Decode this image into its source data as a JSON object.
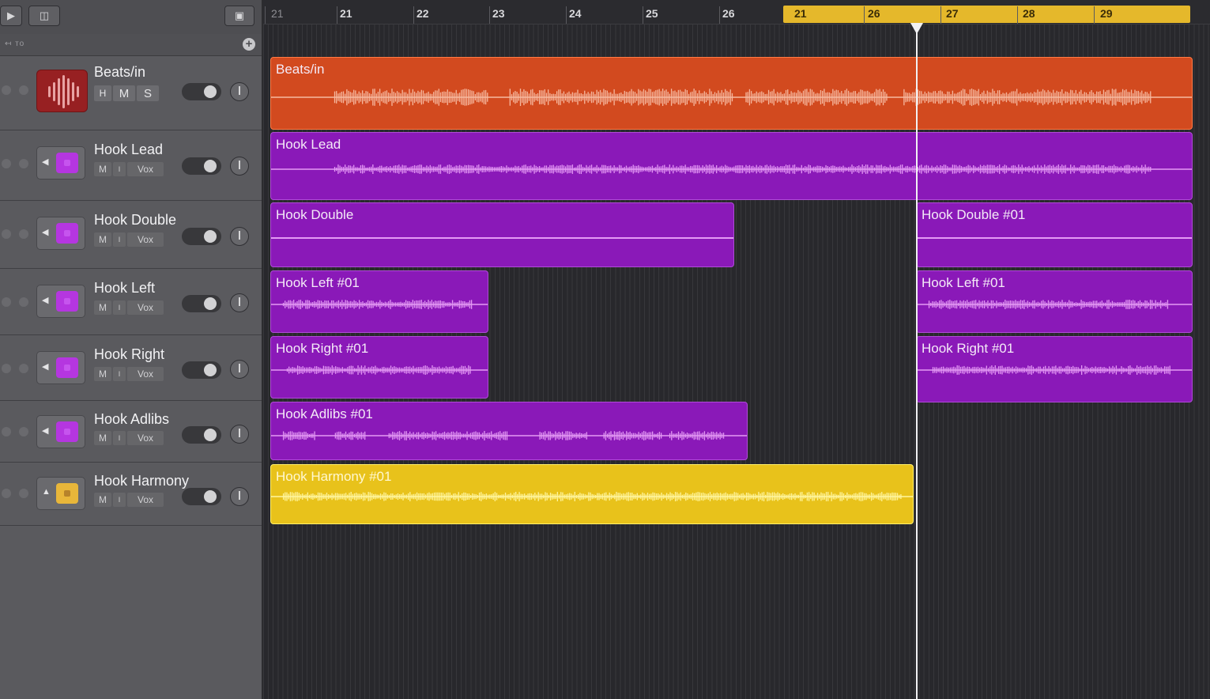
{
  "toolbar": {
    "play_icon": "play-icon",
    "panel_icon": "panel-icon",
    "window_icon": "window-icon"
  },
  "subbar": {
    "label": "↤ то",
    "add_icon": "plus-icon"
  },
  "ruler": {
    "ticks": [
      "21",
      "21",
      "22",
      "23",
      "24",
      "25",
      "26",
      "21",
      "26",
      "27",
      "28",
      "29"
    ]
  },
  "colors": {
    "orange": "#d24a1f",
    "purple": "#8a19b8",
    "yellow": "#e8c21b",
    "cycle": "#e5b82b"
  },
  "tracks": [
    {
      "name": "Beats/in",
      "buttons": [
        "H",
        "M",
        "S"
      ],
      "color": "#972022",
      "regions": [
        {
          "name": "Beats/in"
        }
      ]
    },
    {
      "name": "Hook Lead",
      "buttons": [
        "M",
        "I",
        "Vox"
      ],
      "color": "#b536e0",
      "regions": [
        {
          "name": "Hook Lead"
        }
      ]
    },
    {
      "name": "Hook Double",
      "buttons": [
        "M",
        "I",
        "Vox"
      ],
      "color": "#b536e0",
      "regions": [
        {
          "name": "Hook Double"
        },
        {
          "name": "Hook Double #01"
        }
      ]
    },
    {
      "name": "Hook Left",
      "buttons": [
        "M",
        "I",
        "Vox"
      ],
      "color": "#b536e0",
      "regions": [
        {
          "name": "Hook Left #01"
        },
        {
          "name": "Hook Left #01"
        }
      ]
    },
    {
      "name": "Hook Right",
      "buttons": [
        "M",
        "I",
        "Vox"
      ],
      "color": "#b536e0",
      "regions": [
        {
          "name": "Hook Right #01"
        },
        {
          "name": "Hook Right #01"
        }
      ]
    },
    {
      "name": "Hook Adlibs",
      "buttons": [
        "M",
        "I",
        "Vox"
      ],
      "color": "#b536e0",
      "regions": [
        {
          "name": "Hook Adlibs #01"
        }
      ]
    },
    {
      "name": "Hook Harmony",
      "buttons": [
        "M",
        "I",
        "Vox"
      ],
      "color": "#e8b63a",
      "regions": [
        {
          "name": "Hook Harmony #01"
        }
      ]
    }
  ]
}
